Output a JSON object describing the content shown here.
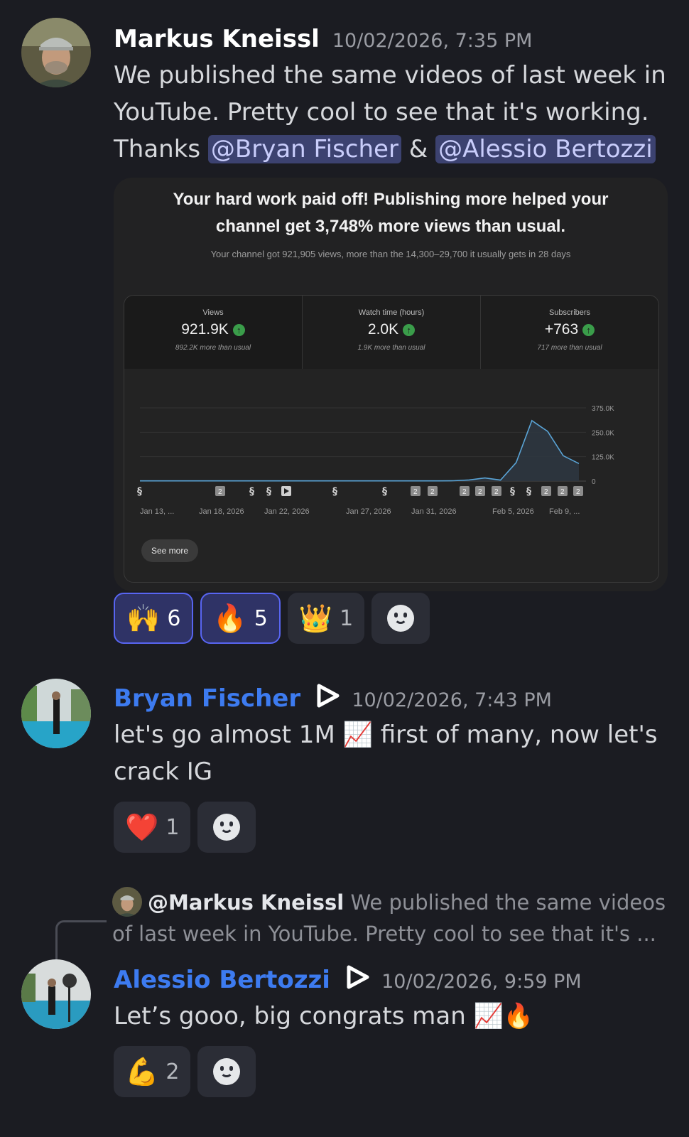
{
  "messages": [
    {
      "author": "Markus Kneissl",
      "timestamp": "10/02/2026, 7:35 PM",
      "text_line1": "We published the same videos of last week in",
      "text_line2": "YouTube. Pretty cool to see that it's working.",
      "text_thanks": "Thanks",
      "mention1": "@Bryan Fischer",
      "amp": "&",
      "mention2": "@Alessio Bertozzi",
      "reactions": [
        {
          "emoji": "🙌",
          "count": "6",
          "active": true
        },
        {
          "emoji": "🔥",
          "count": "5",
          "active": true
        },
        {
          "emoji": "👑",
          "count": "1",
          "active": false
        }
      ]
    },
    {
      "author": "Bryan Fischer",
      "timestamp": "10/02/2026, 7:43 PM",
      "text_line1a": "let's go almost 1M",
      "emoji": "📈",
      "text_line1b": "first of many, now let's",
      "text_line2": "crack IG",
      "reactions": [
        {
          "emoji": "❤️",
          "count": "1",
          "active": false
        }
      ]
    },
    {
      "reply_to": "@Markus Kneissl",
      "reply_preview_1": "We published the same videos",
      "reply_preview_2": "of last week in YouTube. Pretty cool to see that it's ...",
      "author": "Alessio Bertozzi",
      "timestamp": "10/02/2026, 9:59 PM",
      "text": "Let’s gooo, big congrats man",
      "emojis": "📈🔥",
      "reactions": [
        {
          "emoji": "💪",
          "count": "2",
          "active": false
        }
      ]
    }
  ],
  "embed": {
    "headline1": "Your hard work paid off! Publishing more helped your",
    "headline2": "channel get 3,748% more views than usual.",
    "subline": "Your channel got 921,905 views, more than the 14,300–29,700 it usually gets in 28 days",
    "stats": [
      {
        "label": "Views",
        "value": "921.9K",
        "note": "892.2K more than usual"
      },
      {
        "label": "Watch time (hours)",
        "value": "2.0K",
        "note": "1.9K more than usual"
      },
      {
        "label": "Subscribers",
        "value": "+763",
        "note": "717 more than usual"
      }
    ],
    "see_more": "See more"
  },
  "chart_data": {
    "type": "area",
    "x": [
      "Jan 13",
      "Jan 14",
      "Jan 15",
      "Jan 16",
      "Jan 17",
      "Jan 18",
      "Jan 19",
      "Jan 20",
      "Jan 21",
      "Jan 22",
      "Jan 23",
      "Jan 24",
      "Jan 25",
      "Jan 26",
      "Jan 27",
      "Jan 28",
      "Jan 29",
      "Jan 30",
      "Jan 31",
      "Feb 1",
      "Feb 2",
      "Feb 3",
      "Feb 4",
      "Feb 5",
      "Feb 6",
      "Feb 7",
      "Feb 8",
      "Feb 9",
      "Feb 10"
    ],
    "series": [
      {
        "values": [
          1000,
          1000,
          1000,
          1000,
          1000,
          1000,
          1000,
          1000,
          1000,
          1000,
          1000,
          1000,
          1000,
          1000,
          1000,
          1000,
          1000,
          1000,
          1000,
          1000,
          2000,
          6000,
          16000,
          5000,
          95000,
          310000,
          255000,
          130000,
          90000
        ]
      }
    ],
    "yticks": [
      "375.0K",
      "250.0K",
      "125.0K",
      "0"
    ],
    "ylim": [
      0,
      375000
    ],
    "xtick_labels": [
      "Jan 13, ...",
      "Jan 18, 2026",
      "Jan 22, 2026",
      "Jan 27, 2026",
      "Jan 31, 2026",
      "Feb 5, 2026",
      "Feb 9, ..."
    ],
    "markers": [
      "s",
      "2",
      "s",
      "s",
      "play",
      "s",
      "s",
      "2",
      "2",
      "2",
      "2",
      "2",
      "s",
      "s",
      "2",
      "2",
      "2"
    ],
    "marker_label": "2",
    "grid": true,
    "color": "#5aa4d6"
  },
  "colors": {
    "mention_bg": "#3c4270",
    "author_markus": "#ffffff",
    "author_blue": "#3d7bf0",
    "reaction_active_border": "#5865f2"
  }
}
